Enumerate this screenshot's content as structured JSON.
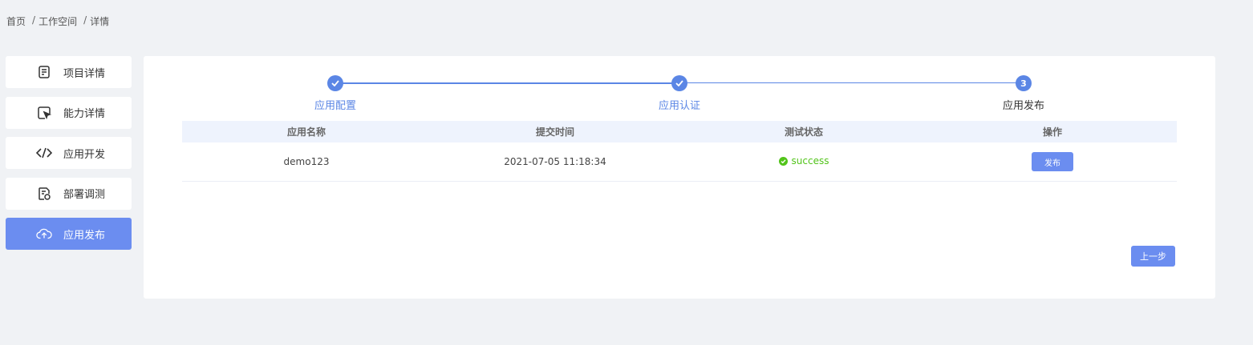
{
  "breadcrumb": {
    "home": "首页",
    "workspace": "工作空间",
    "detail": "详情",
    "separator": "/"
  },
  "sidebar": {
    "items": [
      {
        "label": "项目详情",
        "icon": "document-icon",
        "active": false
      },
      {
        "label": "能力详情",
        "icon": "cursor-icon",
        "active": false
      },
      {
        "label": "应用开发",
        "icon": "code-icon",
        "active": false
      },
      {
        "label": "部署调测",
        "icon": "deploy-file-icon",
        "active": false
      },
      {
        "label": "应用发布",
        "icon": "cloud-upload-icon",
        "active": true
      }
    ]
  },
  "steps": [
    {
      "label": "应用配置",
      "state": "done"
    },
    {
      "label": "应用认证",
      "state": "done"
    },
    {
      "label": "应用发布",
      "state": "current",
      "number": "3"
    }
  ],
  "table": {
    "headers": [
      "应用名称",
      "提交时间",
      "测试状态",
      "操作"
    ],
    "rows": [
      {
        "name": "demo123",
        "time": "2021-07-05 11:18:34",
        "status": "success",
        "action": "发布"
      }
    ]
  },
  "prev_button": "上一步",
  "colors": {
    "primary": "#6b8df0",
    "step": "#5b86e5",
    "success": "#52c41a",
    "background": "#f0f2f5"
  }
}
